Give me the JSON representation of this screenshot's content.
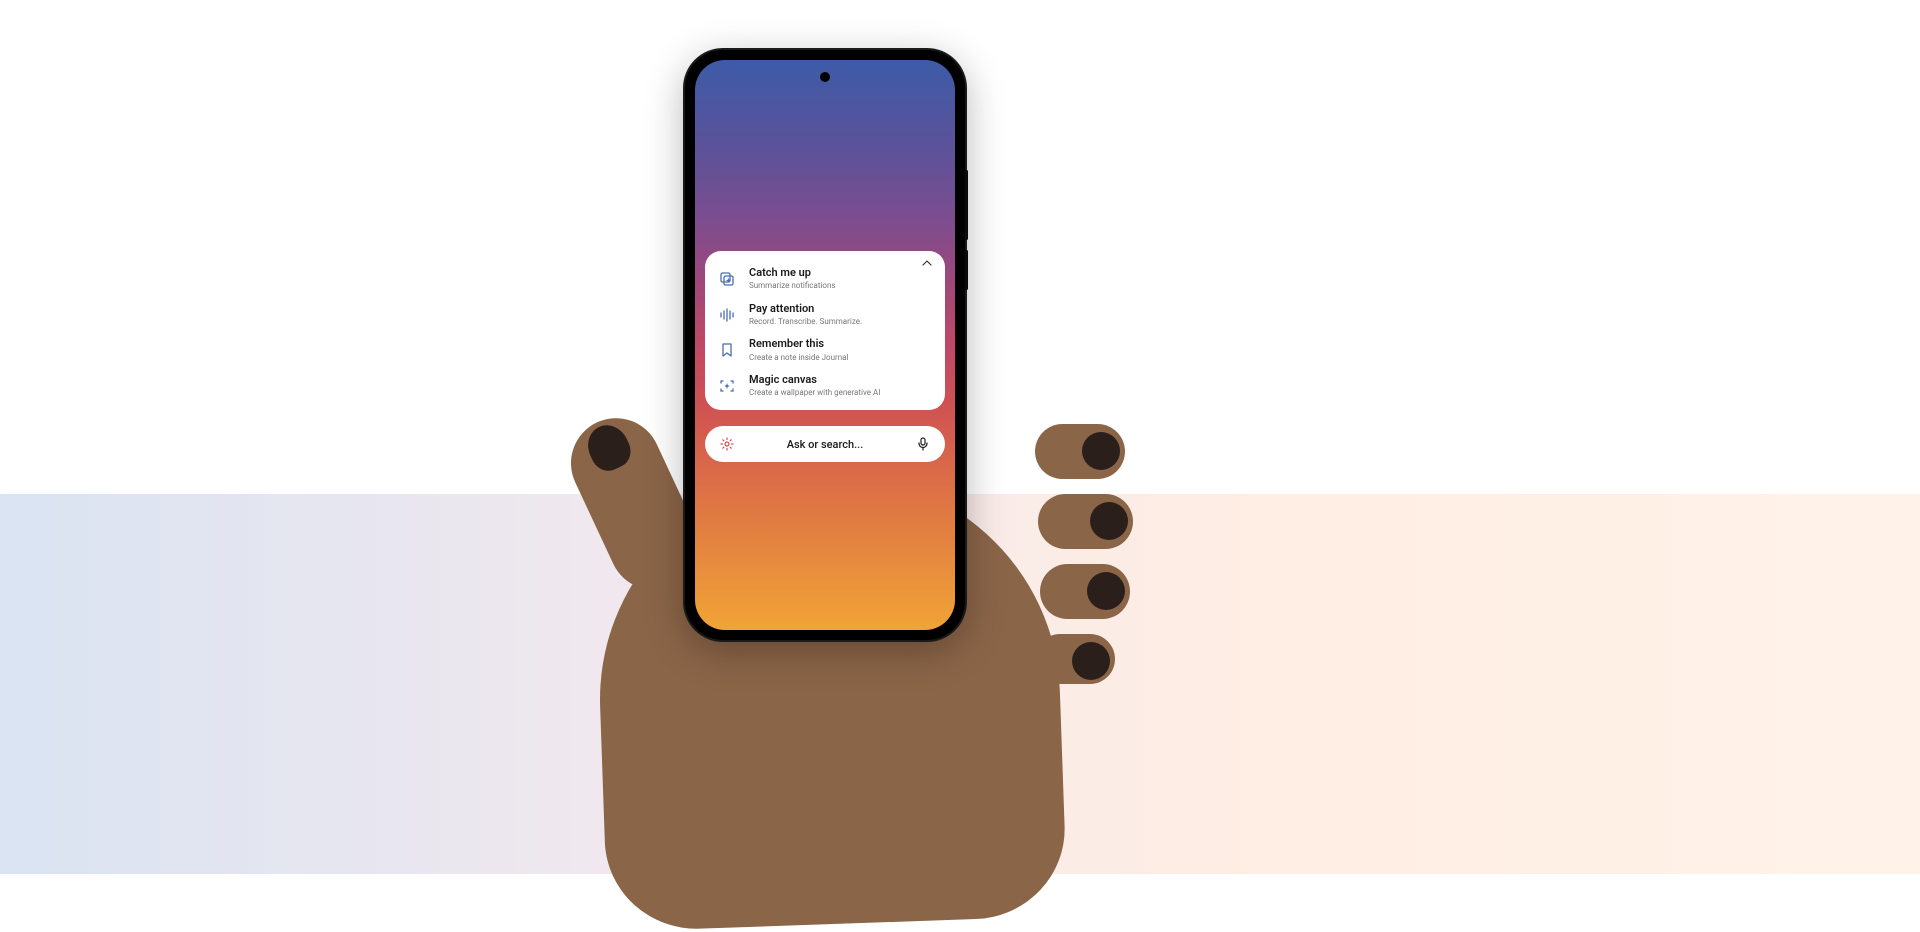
{
  "actions": [
    {
      "title": "Catch me up",
      "subtitle": "Summarize notifications",
      "icon": "cards"
    },
    {
      "title": "Pay attention",
      "subtitle": "Record. Transcribe. Summarize.",
      "icon": "waveform"
    },
    {
      "title": "Remember this",
      "subtitle": "Create a note inside Journal",
      "icon": "bookmark"
    },
    {
      "title": "Magic canvas",
      "subtitle": "Create a wallpaper with generative AI",
      "icon": "sparkle-frame"
    }
  ],
  "search": {
    "placeholder": "Ask or search..."
  },
  "colors": {
    "icon_accent": "#4a6db3",
    "settings_accent": "#d84c4c"
  }
}
